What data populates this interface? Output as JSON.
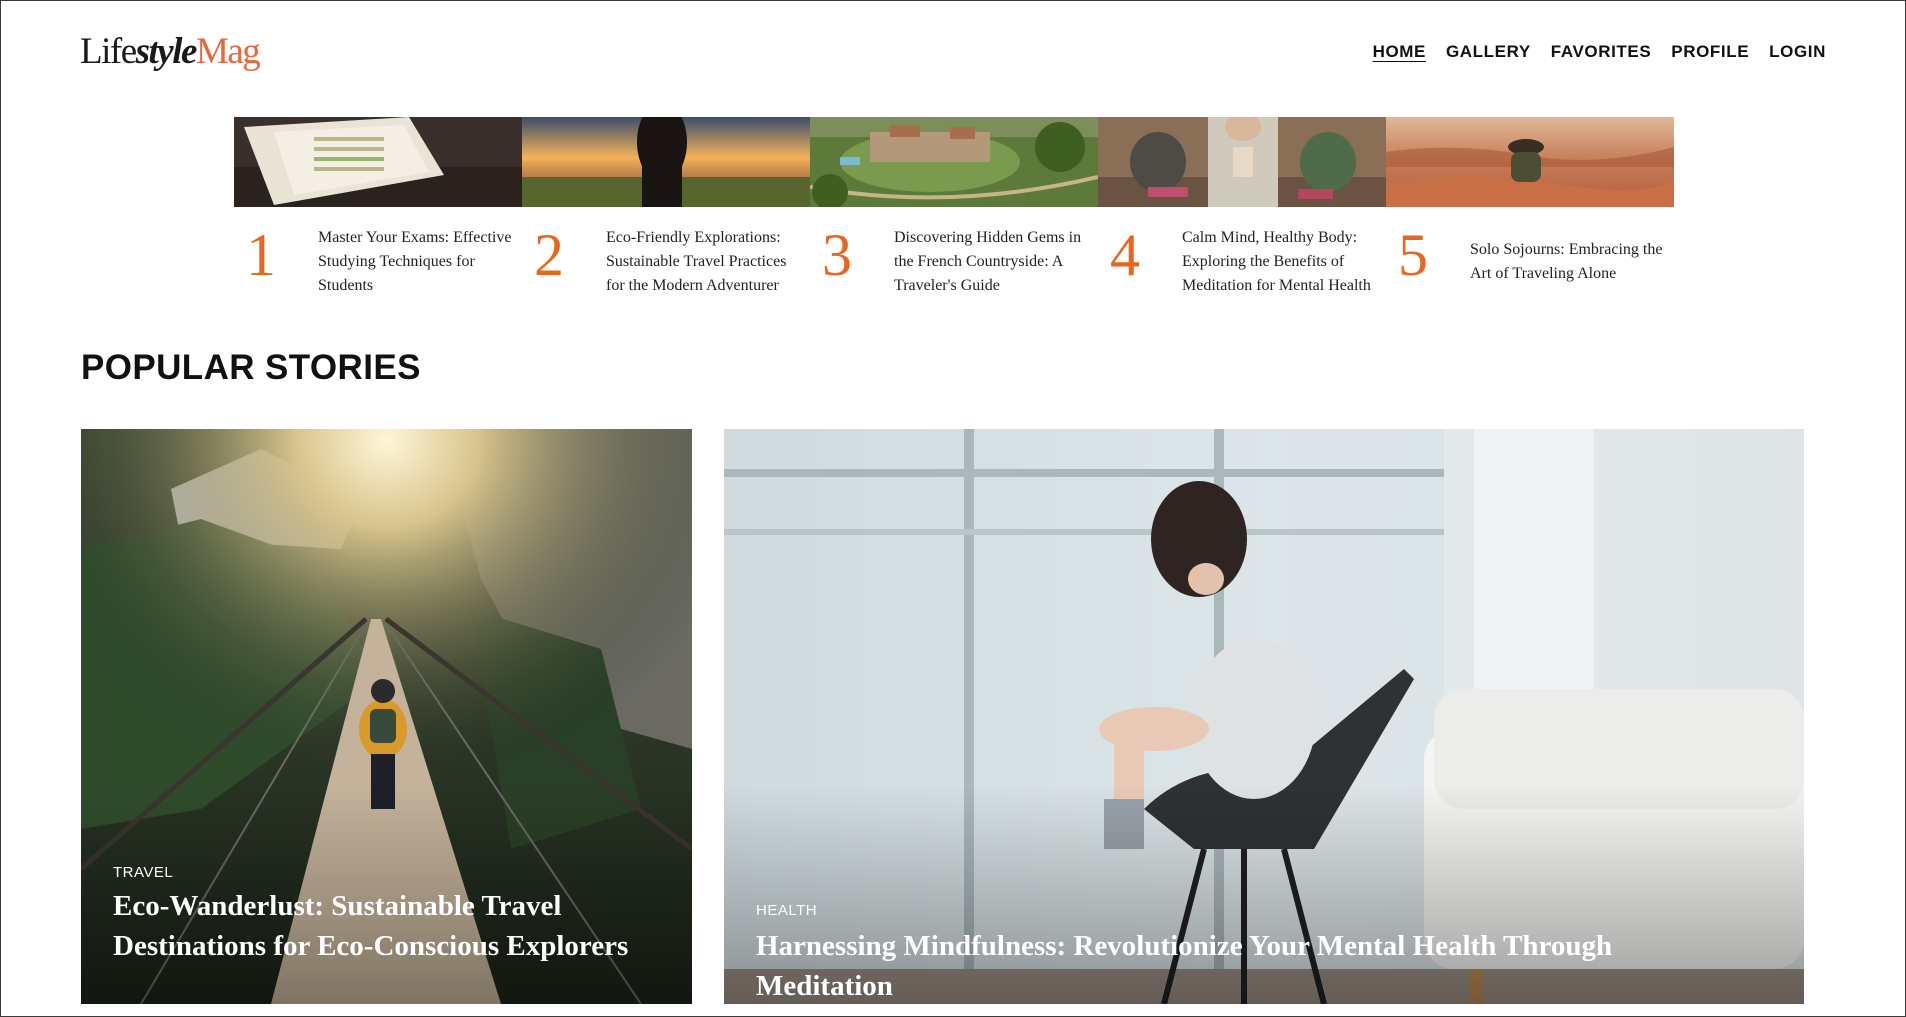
{
  "brand": {
    "part1": "Life",
    "part2": "style",
    "part3": "Mag",
    "accent_color": "#e8673c"
  },
  "nav": {
    "items": [
      {
        "label": "HOME",
        "active": true
      },
      {
        "label": "GALLERY"
      },
      {
        "label": "FAVORITES"
      },
      {
        "label": "PROFILE"
      },
      {
        "label": "LOGIN"
      }
    ]
  },
  "trending": [
    {
      "number": "1",
      "title": "Master Your Exams: Effective Studying Techniques for Students"
    },
    {
      "number": "2",
      "title": "Eco-Friendly Explorations: Sustainable Travel Practices for the Modern Adventurer"
    },
    {
      "number": "3",
      "title": "Discovering Hidden Gems in the French Countryside: A Traveler's Guide"
    },
    {
      "number": "4",
      "title": "Calm Mind, Healthy Body: Exploring the Benefits of Meditation for Mental Health"
    },
    {
      "number": "5",
      "title": "Solo Sojourns: Embracing the Art of Traveling Alone"
    }
  ],
  "popular": {
    "heading": "POPULAR STORIES",
    "stories": [
      {
        "category": "TRAVEL",
        "title": "Eco-Wanderlust: Sustainable Travel Destinations for Eco-Conscious Explorers"
      },
      {
        "category": "HEALTH",
        "title": "Harnessing Mindfulness: Revolutionize Your Mental Health Through Meditation"
      }
    ]
  }
}
